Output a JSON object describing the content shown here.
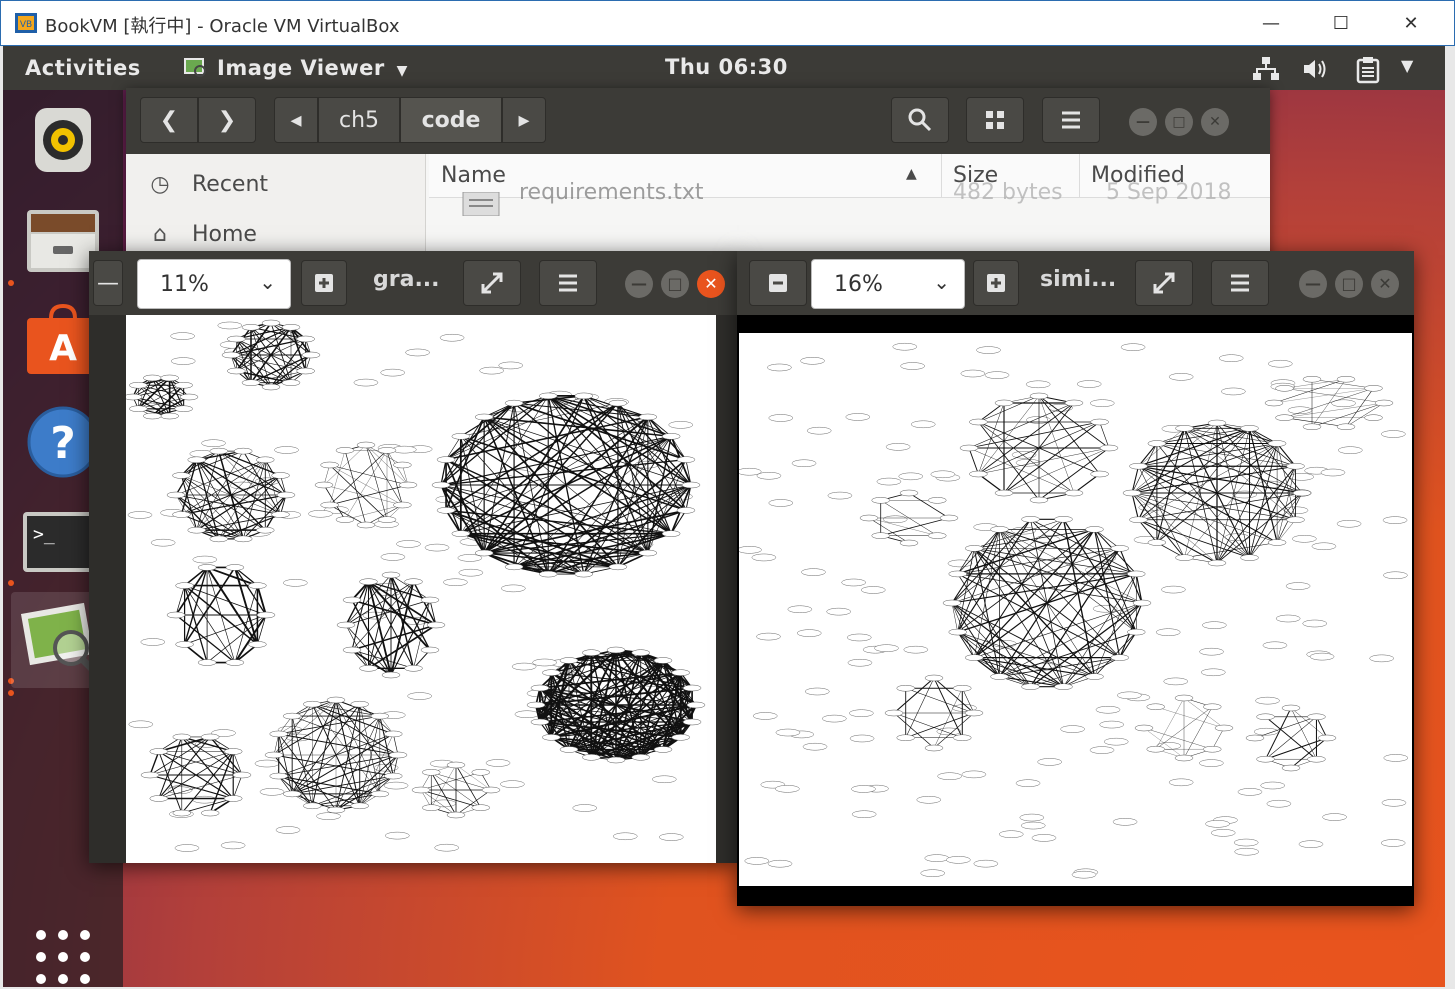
{
  "host_window": {
    "title": "BookVM [執行中] - Oracle VM VirtualBox",
    "controls": [
      "minimize",
      "maximize",
      "close"
    ]
  },
  "topbar": {
    "activities": "Activities",
    "app_menu": "Image Viewer",
    "clock": "Thu 06:30",
    "tray_icons": [
      "network-icon",
      "volume-icon",
      "clipboard-icon",
      "system-menu-arrow"
    ]
  },
  "dock": {
    "apps": [
      {
        "name": "Rhythmbox",
        "icon": "speaker-icon",
        "running": false
      },
      {
        "name": "Files",
        "icon": "file-cabinet-icon",
        "running": true
      },
      {
        "name": "Ubuntu Software",
        "icon": "software-bag-icon",
        "running": false
      },
      {
        "name": "Help",
        "icon": "help-icon",
        "running": false
      },
      {
        "name": "Terminal",
        "icon": "terminal-icon",
        "running": true
      },
      {
        "name": "Image Viewer",
        "icon": "image-viewer-icon",
        "running": true
      }
    ],
    "show_apps_icon": "app-grid-icon"
  },
  "files": {
    "breadcrumbs": [
      "ch5",
      "code"
    ],
    "sidebar": [
      {
        "label": "Recent",
        "icon": "clock-icon"
      },
      {
        "label": "Home",
        "icon": "home-icon"
      }
    ],
    "columns": [
      "Name",
      "Size",
      "Modified"
    ],
    "rows": [
      {
        "name": "requirements.txt",
        "size": "482 bytes",
        "modified": "5 Sep 2018"
      }
    ]
  },
  "viewer_left": {
    "zoom": "11%",
    "title": "gra..."
  },
  "viewer_right": {
    "zoom": "16%",
    "title": "simi..."
  },
  "colors": {
    "panel": "#3c3b37",
    "accent": "#e9541e",
    "text_light": "#e9e9e9"
  }
}
